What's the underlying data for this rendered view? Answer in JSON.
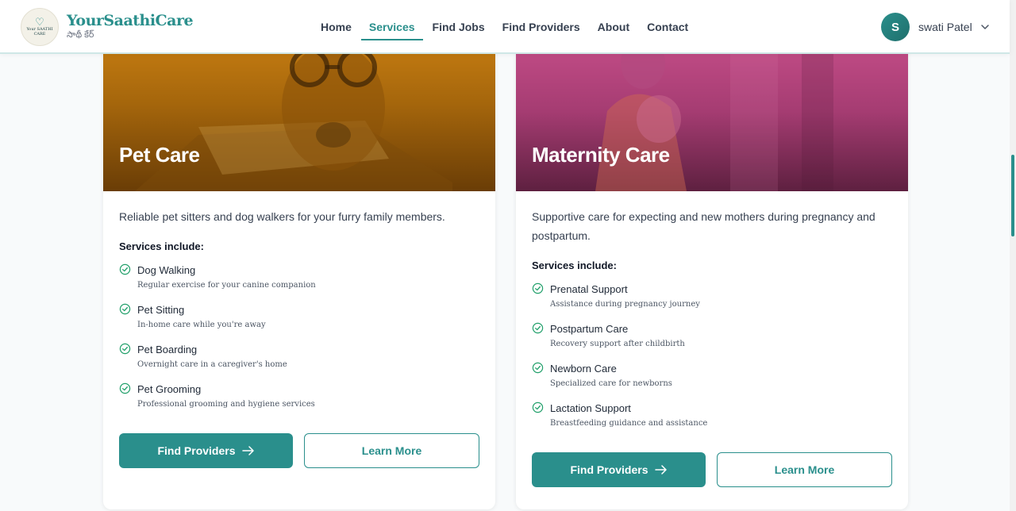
{
  "brand": {
    "name": "YourSaathiCare",
    "tagline": "సాథీ కేర్",
    "badge_text": "Your SAATHI CARE"
  },
  "nav": [
    {
      "label": "Home",
      "active": false
    },
    {
      "label": "Services",
      "active": true
    },
    {
      "label": "Find Jobs",
      "active": false
    },
    {
      "label": "Find Providers",
      "active": false
    },
    {
      "label": "About",
      "active": false
    },
    {
      "label": "Contact",
      "active": false
    }
  ],
  "user": {
    "initial": "S",
    "name": "swati Patel"
  },
  "colors": {
    "accent": "#2a8f8c",
    "pet_banner": "#a5660c",
    "maternity_banner": "#a53c72"
  },
  "cards": [
    {
      "title": "Pet Care",
      "description": "Reliable pet sitters and dog walkers for your furry family members.",
      "includes_label": "Services include:",
      "services": [
        {
          "name": "Dog Walking",
          "detail": "Regular exercise for your canine companion"
        },
        {
          "name": "Pet Sitting",
          "detail": "In-home care while you're away"
        },
        {
          "name": "Pet Boarding",
          "detail": "Overnight care in a caregiver's home"
        },
        {
          "name": "Pet Grooming",
          "detail": "Professional grooming and hygiene services"
        }
      ],
      "primary_button": "Find Providers",
      "secondary_button": "Learn More"
    },
    {
      "title": "Maternity Care",
      "description": "Supportive care for expecting and new mothers during pregnancy and postpartum.",
      "includes_label": "Services include:",
      "services": [
        {
          "name": "Prenatal Support",
          "detail": "Assistance during pregnancy journey"
        },
        {
          "name": "Postpartum Care",
          "detail": "Recovery support after childbirth"
        },
        {
          "name": "Newborn Care",
          "detail": "Specialized care for newborns"
        },
        {
          "name": "Lactation Support",
          "detail": "Breastfeeding guidance and assistance"
        }
      ],
      "primary_button": "Find Providers",
      "secondary_button": "Learn More"
    }
  ],
  "icons": {
    "check": "check-circle-icon",
    "arrow": "arrow-right-icon",
    "chevron": "chevron-down-icon"
  }
}
